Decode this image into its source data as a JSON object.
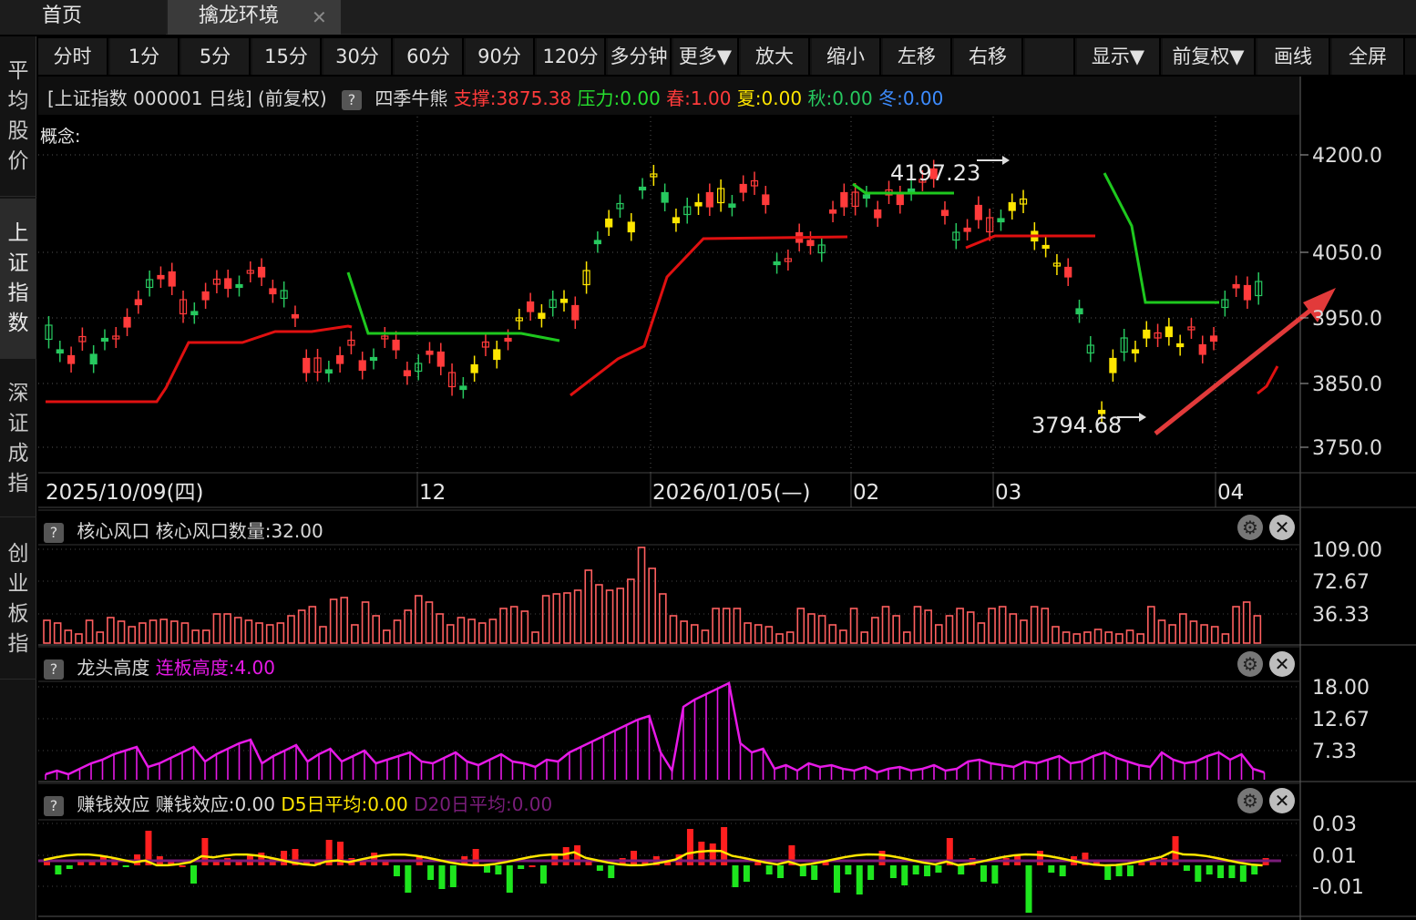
{
  "tabs": {
    "home": "首页",
    "active": "擒龙环境",
    "close": "✕"
  },
  "sidebar": [
    {
      "label": "平均股价",
      "active": false
    },
    {
      "label": "上证指数",
      "active": true
    },
    {
      "label": "深证成指",
      "active": false
    },
    {
      "label": "创业板指",
      "active": false
    }
  ],
  "toolbar": [
    "分时",
    "1分",
    "5分",
    "15分",
    "30分",
    "60分",
    "90分",
    "120分",
    "多分钟",
    "更多▼",
    "放大",
    "缩小",
    "左移",
    "右移",
    "显示▼",
    "前复权▼",
    "画线",
    "全屏"
  ],
  "main_header": {
    "title": "[上证指数 000001 日线] (前复权)",
    "qmark": "?",
    "indicator": "四季牛熊",
    "support": "支撑:3875.38",
    "pressure": "压力:0.00",
    "spring": "春:1.00",
    "summer": "夏:0.00",
    "autumn": "秋:0.00",
    "winter": "冬:0.00",
    "concept": "概念:"
  },
  "colors": {
    "up": "#ff3b3b",
    "down": "#27c85f",
    "yellow": "#ffe600",
    "support_line": "#e01010",
    "pressure_line": "#1ec81e",
    "magenta": "#e619e6",
    "arrow": "#e23a3a"
  },
  "main_axis": {
    "ticks": [
      "4200.0",
      "4050.0",
      "3950.0",
      "3850.0",
      "3750.0"
    ]
  },
  "annotations": {
    "high": "4197.23",
    "low": "3794.68"
  },
  "date_axis": [
    "2025/10/09(四)",
    "12",
    "2026/01/05(—)",
    "02",
    "03",
    "04"
  ],
  "panel1": {
    "title": "核心风口",
    "value": "核心风口数量:32.00",
    "ticks": [
      "109.00",
      "72.67",
      "36.33"
    ]
  },
  "panel2": {
    "title": "龙头高度",
    "value": "连板高度:4.00",
    "ticks": [
      "18.00",
      "12.67",
      "7.33"
    ]
  },
  "panel3": {
    "title": "赚钱效应",
    "value": "赚钱效应:0.00",
    "d5": "D5日平均:0.00",
    "d20": "D20日平均:0.00",
    "ticks": [
      "0.03",
      "0.01",
      "-0.01"
    ]
  }
}
